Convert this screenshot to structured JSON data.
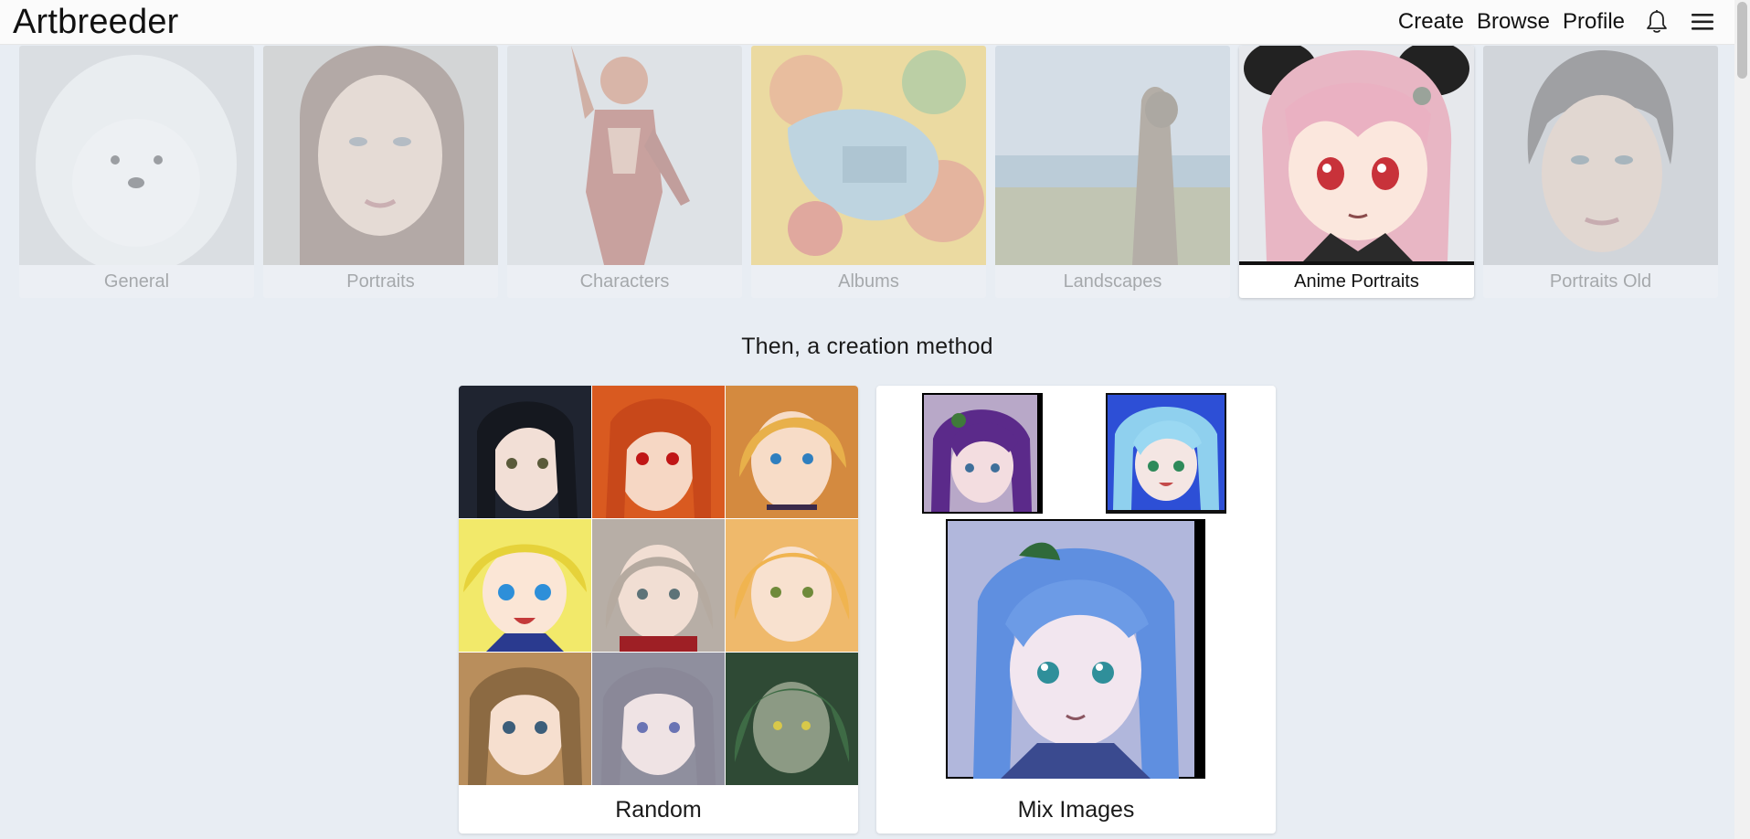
{
  "header": {
    "logo": "Artbreeder",
    "nav": {
      "create": "Create",
      "browse": "Browse",
      "profile": "Profile"
    },
    "icons": [
      "bell-icon",
      "hamburger-menu-icon"
    ]
  },
  "categories": [
    {
      "label": "General",
      "active": false
    },
    {
      "label": "Portraits",
      "active": false
    },
    {
      "label": "Characters",
      "active": false
    },
    {
      "label": "Albums",
      "active": false
    },
    {
      "label": "Landscapes",
      "active": false
    },
    {
      "label": "Anime Portraits",
      "active": true
    },
    {
      "label": "Portraits Old",
      "active": false
    }
  ],
  "section_title": "Then, a creation method",
  "methods": {
    "random": {
      "label": "Random"
    },
    "mix": {
      "label": "Mix Images"
    }
  },
  "colors": {
    "background": "#e8edf3",
    "card": "#ffffff",
    "active_underline": "#111111"
  }
}
